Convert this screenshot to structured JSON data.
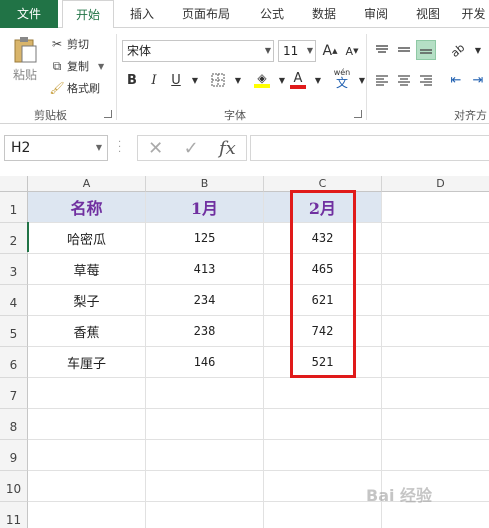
{
  "ribbon_tabs": {
    "file": "文件",
    "home": "开始",
    "insert": "插入",
    "page_layout": "页面布局",
    "formulas": "公式",
    "data": "数据",
    "review": "审阅",
    "view": "视图",
    "more": "开发"
  },
  "clipboard": {
    "paste": "粘贴",
    "cut": "剪切",
    "copy": "复制",
    "format_painter": "格式刷",
    "group_label": "剪贴板"
  },
  "font": {
    "name": "宋体",
    "size": "11",
    "bold": "B",
    "italic": "I",
    "underline": "U",
    "font_color_letter": "A",
    "phonetic": "wén",
    "group_label": "字体"
  },
  "alignment": {
    "group_label": "对齐方"
  },
  "formula_bar": {
    "name_box": "H2",
    "fx": "fx",
    "cancel": "✕",
    "enter": "✓",
    "value": ""
  },
  "columns": [
    "A",
    "B",
    "C",
    "D"
  ],
  "rows": [
    "1",
    "2",
    "3",
    "4",
    "5",
    "6",
    "7",
    "8",
    "9",
    "10",
    "11"
  ],
  "table": {
    "headers": [
      "名称",
      "1月",
      "2月"
    ],
    "data": [
      [
        "哈密瓜",
        "125",
        "432"
      ],
      [
        "草莓",
        "413",
        "465"
      ],
      [
        "梨子",
        "234",
        "621"
      ],
      [
        "香蕉",
        "238",
        "742"
      ],
      [
        "车厘子",
        "146",
        "521"
      ]
    ]
  },
  "colors": {
    "excel_green": "#217346",
    "header_fill": "#dde6f1",
    "header_text": "#7030a0",
    "highlight_border": "#e01a1a"
  },
  "watermark": "Bai 经验"
}
